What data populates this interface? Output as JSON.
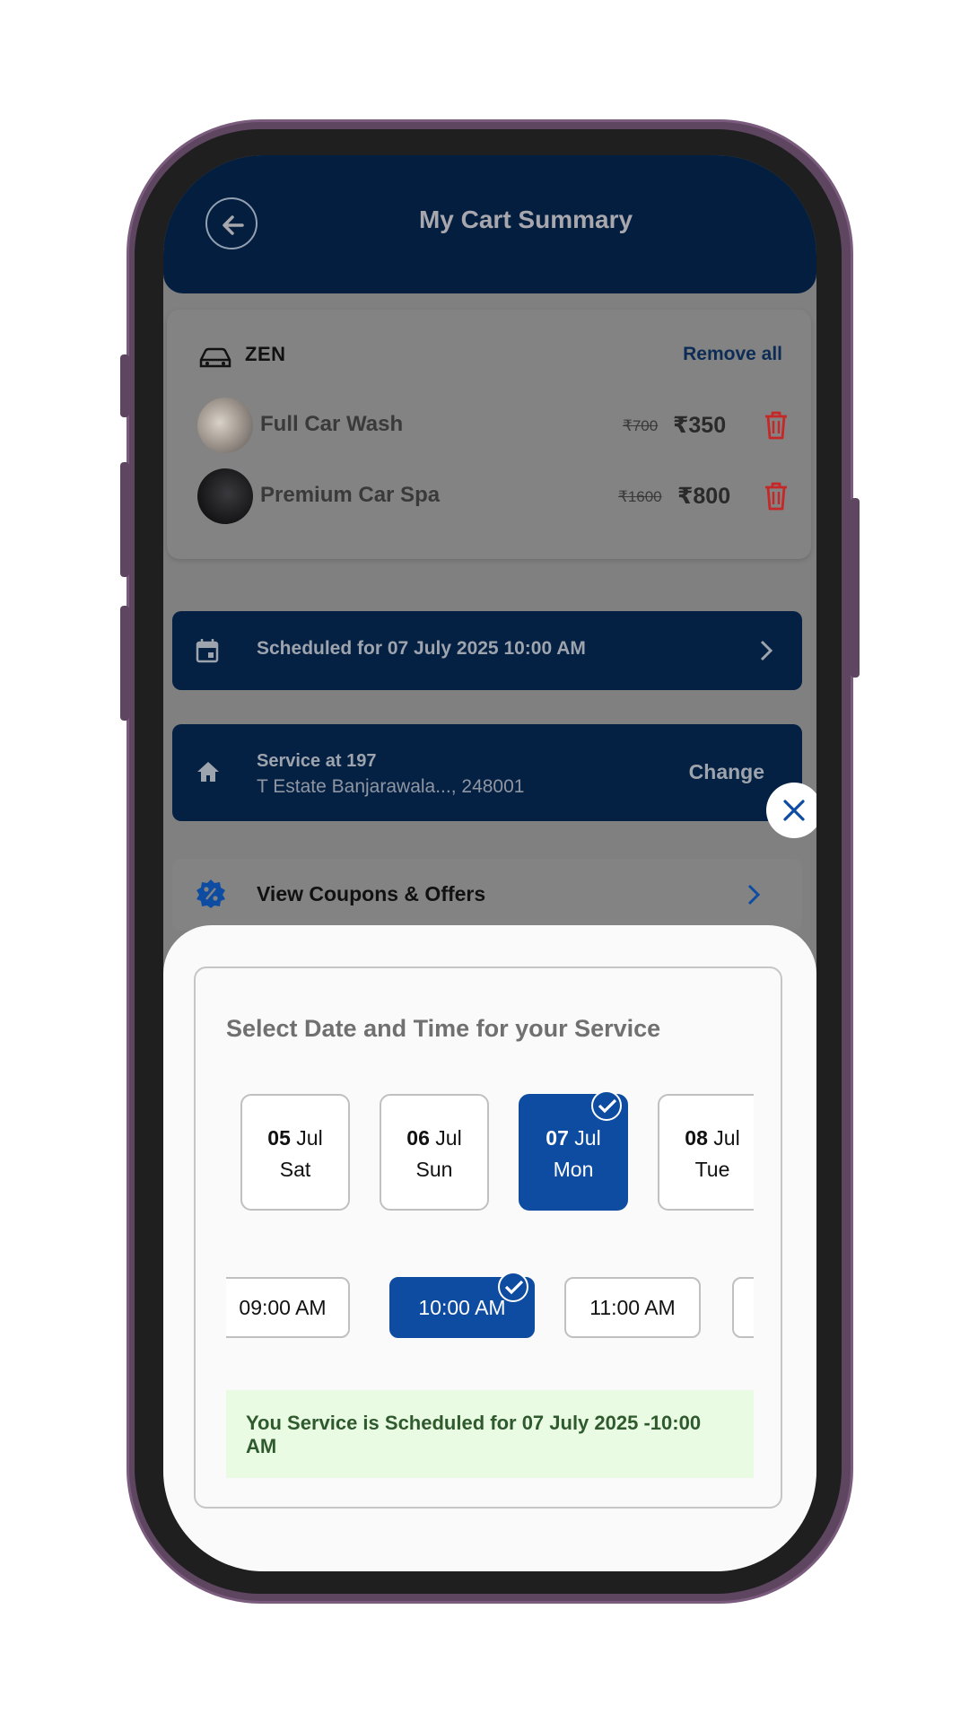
{
  "header": {
    "title": "My Cart Summary"
  },
  "cart": {
    "vehicle": "ZEN",
    "remove_all": "Remove all",
    "items": [
      {
        "name": "Full Car Wash",
        "old_price": "₹700",
        "price": "₹350"
      },
      {
        "name": "Premium Car Spa",
        "old_price": "₹1600",
        "price": "₹800"
      }
    ]
  },
  "schedule": {
    "text": "Scheduled for 07 July 2025 10:00 AM"
  },
  "address": {
    "line1": "Service at 197",
    "line2": "T Estate Banjarawala..., 248001",
    "change": "Change"
  },
  "coupons": {
    "label": "View Coupons & Offers"
  },
  "sheet": {
    "title": "Select Date and Time for your Service",
    "dates": [
      {
        "day": "05",
        "month": "Jul",
        "weekday": "Sat"
      },
      {
        "day": "06",
        "month": "Jul",
        "weekday": "Sun"
      },
      {
        "day": "07",
        "month": "Jul",
        "weekday": "Mon"
      },
      {
        "day": "08",
        "month": "Jul",
        "weekday": "Tue"
      }
    ],
    "times": [
      "09:00 AM",
      "10:00 AM",
      "11:00 AM"
    ],
    "notice": "You Service is Scheduled for 07 July 2025 -10:00 AM"
  },
  "colors": {
    "primary": "#0e4ca1",
    "header": "#031e3f",
    "notice_bg": "#eafbe3",
    "delete": "#c62828"
  }
}
